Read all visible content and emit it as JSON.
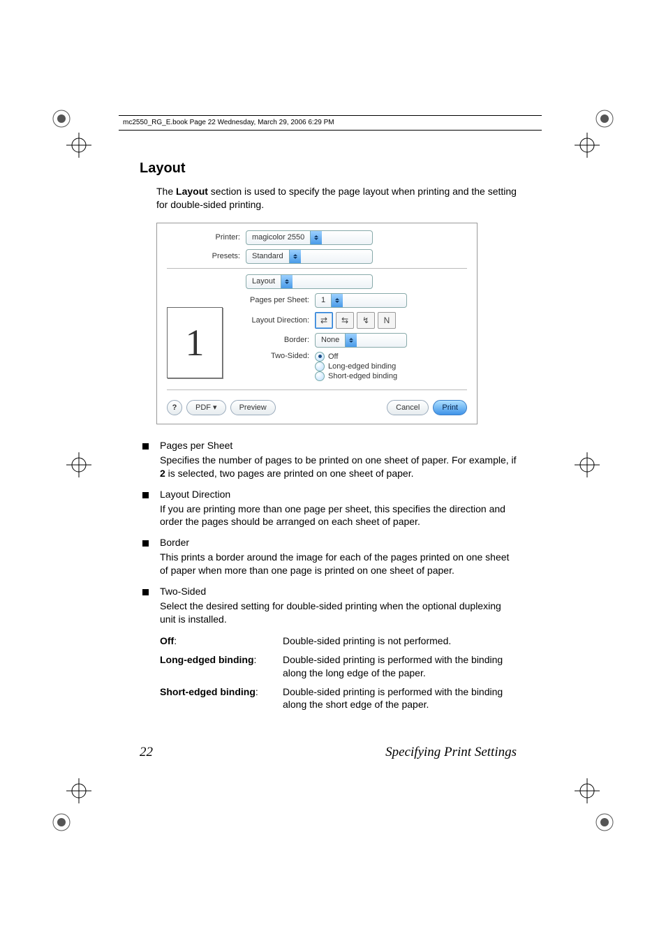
{
  "header_meta": "mc2550_RG_E.book  Page 22  Wednesday, March 29, 2006  6:29 PM",
  "section_title": "Layout",
  "intro": "The Layout section is used to specify the page layout when printing and the setting for double-sided printing.",
  "dialog": {
    "printer_label": "Printer:",
    "printer_value": "magicolor 2550",
    "presets_label": "Presets:",
    "presets_value": "Standard",
    "panel_value": "Layout",
    "pps_label": "Pages per Sheet:",
    "pps_value": "1",
    "ld_label": "Layout Direction:",
    "border_label": "Border:",
    "border_value": "None",
    "ts_label": "Two-Sided:",
    "ts_off": "Off",
    "ts_long": "Long-edged binding",
    "ts_short": "Short-edged binding",
    "preview_number": "1",
    "help": "?",
    "pdf": "PDF ▾",
    "preview_btn": "Preview",
    "cancel": "Cancel",
    "print": "Print"
  },
  "bullets": {
    "pps_t": "Pages per Sheet",
    "pps_b": "Specifies the number of pages to be printed on one sheet of paper. For example, if 2 is selected, two pages are printed on one sheet of paper.",
    "ld_t": "Layout Direction",
    "ld_b": "If you are printing more than one page per sheet, this specifies the direction and order the pages should be arranged on each sheet of paper.",
    "bd_t": "Border",
    "bd_b": "This prints a border around the image for each of the pages printed on one sheet of paper when more than one page is printed on one sheet of paper.",
    "ts_t": "Two-Sided",
    "ts_b": "Select the desired setting for double-sided printing when the optional duplexing unit is installed."
  },
  "defs": {
    "off_t": "Off",
    "off_d": "Double-sided printing is not performed.",
    "long_t": "Long-edged binding",
    "long_d": "Double-sided printing is performed with the binding along the long edge of the paper.",
    "short_t": "Short-edged binding",
    "short_d": "Double-sided printing is performed with the binding along the short edge of the paper."
  },
  "footer": {
    "page": "22",
    "title": "Specifying Print Settings"
  }
}
